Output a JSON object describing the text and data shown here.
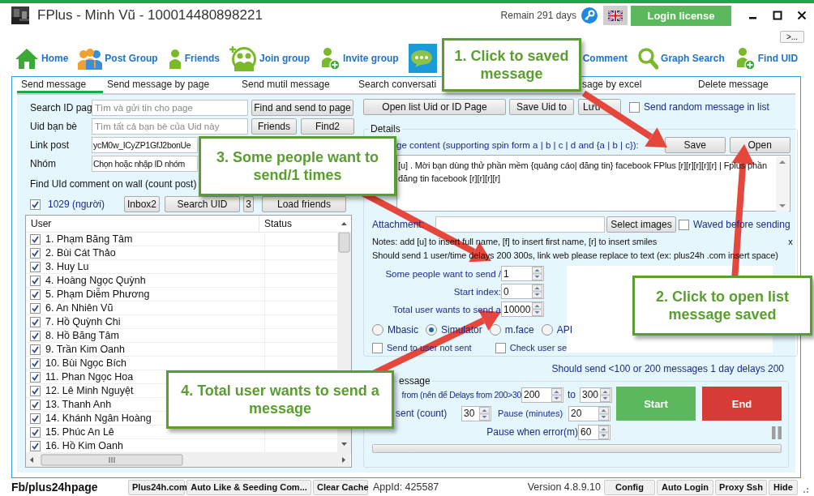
{
  "window": {
    "title": "FPlus - Minh Vũ - 100014480898221",
    "remaining": "Remain 291 days",
    "login_button": "Login license",
    "more_button": ">..."
  },
  "toolbar": [
    {
      "kind": "home",
      "label": "Home",
      "selected": false
    },
    {
      "kind": "post-group",
      "label": "Post Group",
      "selected": false
    },
    {
      "kind": "friends",
      "label": "Friends",
      "selected": false
    },
    {
      "kind": "join-group",
      "label": "Join group",
      "selected": false
    },
    {
      "kind": "invite-group",
      "label": "Invite group",
      "selected": false
    },
    {
      "kind": "chat",
      "selected": true
    },
    {
      "kind": "comment",
      "label": "Comment",
      "selected": false
    },
    {
      "kind": "graph-search",
      "label": "Graph Search",
      "selected": false
    },
    {
      "kind": "find-uid",
      "label": "Find UID",
      "selected": false
    }
  ],
  "tabs": [
    {
      "label": "Send message",
      "selected": true
    },
    {
      "label": "Send message by page",
      "selected": false
    },
    {
      "label": "Send mutil message",
      "selected": false
    },
    {
      "label": "Search conversati",
      "selected": false
    },
    {
      "label": "sage by excel",
      "selected": false
    },
    {
      "label": "Delete message",
      "selected": false
    }
  ],
  "search_page": {
    "label": "Search ID pag",
    "placeholder": "Tìm và gửi tin cho page",
    "button": "Find and send to page"
  },
  "friend_uid": {
    "label": "Uid bạn bè",
    "placeholder": "Tìm tất cả bạn bè của Uid này",
    "buttons": [
      "Friends",
      "Find2"
    ]
  },
  "link_post": {
    "label": "Link post",
    "value": "ycM0w_ICyZP1GfJ2bonUe"
  },
  "group": {
    "label": "Nhóm",
    "value": "Chọn hoặc nhập ID nhóm"
  },
  "find_comment_label": "Find UId comment on wall (count post)",
  "select_all": {
    "label": "1029 (người)",
    "checked": true
  },
  "list_buttons": [
    "Inbox2",
    "Search UID",
    "3",
    "Load friends"
  ],
  "user_table": {
    "columns": [
      "User",
      "Status"
    ],
    "rows": [
      {
        "name": "1. Phạm Băng Tâm",
        "checked": true
      },
      {
        "name": "2. Bùi Cát Thảo",
        "checked": true
      },
      {
        "name": "3. Huy Lu",
        "checked": true
      },
      {
        "name": "4. Hoàng Ngọc Quỳnh",
        "checked": true
      },
      {
        "name": "5. Phạm Diễm Phương",
        "checked": true
      },
      {
        "name": "6. An Nhiên Vũ",
        "checked": true
      },
      {
        "name": "7. Hồ Quỳnh Chi",
        "checked": true
      },
      {
        "name": "8. Hồ Băng Tâm",
        "checked": true
      },
      {
        "name": "9. Trần Kim Oanh",
        "checked": true
      },
      {
        "name": "10. Bùi Ngọc Bích",
        "checked": true
      },
      {
        "name": "11. Phan Ngọc Hoa",
        "checked": true
      },
      {
        "name": "12. Lê Minh Nguyệt",
        "checked": true
      },
      {
        "name": "13. Thanh Anh",
        "checked": true
      },
      {
        "name": "14. Khánh Ngân Hoàng",
        "checked": true
      },
      {
        "name": "15. Phúc An Lê",
        "checked": true
      },
      {
        "name": "16. Hồ Kim Oanh",
        "checked": true
      }
    ]
  },
  "top_buttons": [
    "Open list Uid or ID Page",
    "Save Uid to",
    "Lưu"
  ],
  "random_message": {
    "label": "Send random message in list",
    "checked": false
  },
  "details": {
    "legend": "Details",
    "content_label": "ge content (supporting spin form a | b | c | d and {a | b | c}):",
    "buttons": [
      "Save",
      "Open"
    ],
    "content": [
      "[u] . Mời bạn dùng thử phần mềm {quảng cáo| đăng tin} facebook FPlus [r][r][r][r][r] | Fplus phần",
      "đăng tin facebook [r][r][r][r]"
    ],
    "attachment_label": "Attachment:",
    "select_images": "Select images",
    "waved": {
      "label": "Waved before sending",
      "checked": false
    },
    "notes": [
      "Notes: add [u] to insert full name, [f] to insert first name, [r] to insert smiles",
      "Should send 1 user/time delays 200 300s, link web please replace to text (ex: plus24h .com insert space)"
    ],
    "close": "x",
    "spinners": [
      {
        "label": "Some people want to send /",
        "value": "1"
      },
      {
        "label": "Start index:",
        "value": "0"
      },
      {
        "label": "Total user wants to send a",
        "value": "10000"
      }
    ],
    "modes": [
      {
        "label": "Mbasic",
        "selected": false
      },
      {
        "label": "Simulator",
        "selected": true
      },
      {
        "label": "m.face",
        "selected": false
      },
      {
        "label": "API",
        "selected": false
      }
    ],
    "options": [
      {
        "label": "Send to user not sent",
        "checked": false
      },
      {
        "label": "Check user se",
        "checked": false
      }
    ]
  },
  "advice": "Should send <100 or 200 messages 1 day delays 200",
  "schedule": {
    "legend": "essage",
    "delay_label": "from (nên để Delays from 200>30",
    "delay_from": "200",
    "to_label": "to",
    "delay_to": "300",
    "sent_label": "sent (count)",
    "sent": "30",
    "pause_label": "Pause (minutes)",
    "pause": "20",
    "error_label": "Pause when error(m)",
    "error": "60",
    "start": "Start",
    "end": "End",
    "progress": {
      "level": 0
    }
  },
  "status_bar": {
    "page": "Fb/plus24hpage",
    "buttons_left": [
      "Plus24h.com",
      "Auto Like & Seeding Com...",
      "Clear Cache"
    ],
    "app_id": "AppId: 425587",
    "version": "Version 4.8.9.10",
    "buttons_right": [
      "Config",
      "Auto Login",
      "Proxy Ssh",
      "Hide"
    ]
  },
  "callouts": [
    {
      "text": "1. Click to saved message"
    },
    {
      "text": "2. Click to open list message saved"
    },
    {
      "text": "3. Some people want to send/1 times"
    },
    {
      "text": "4. Total user wants to send a message"
    }
  ]
}
